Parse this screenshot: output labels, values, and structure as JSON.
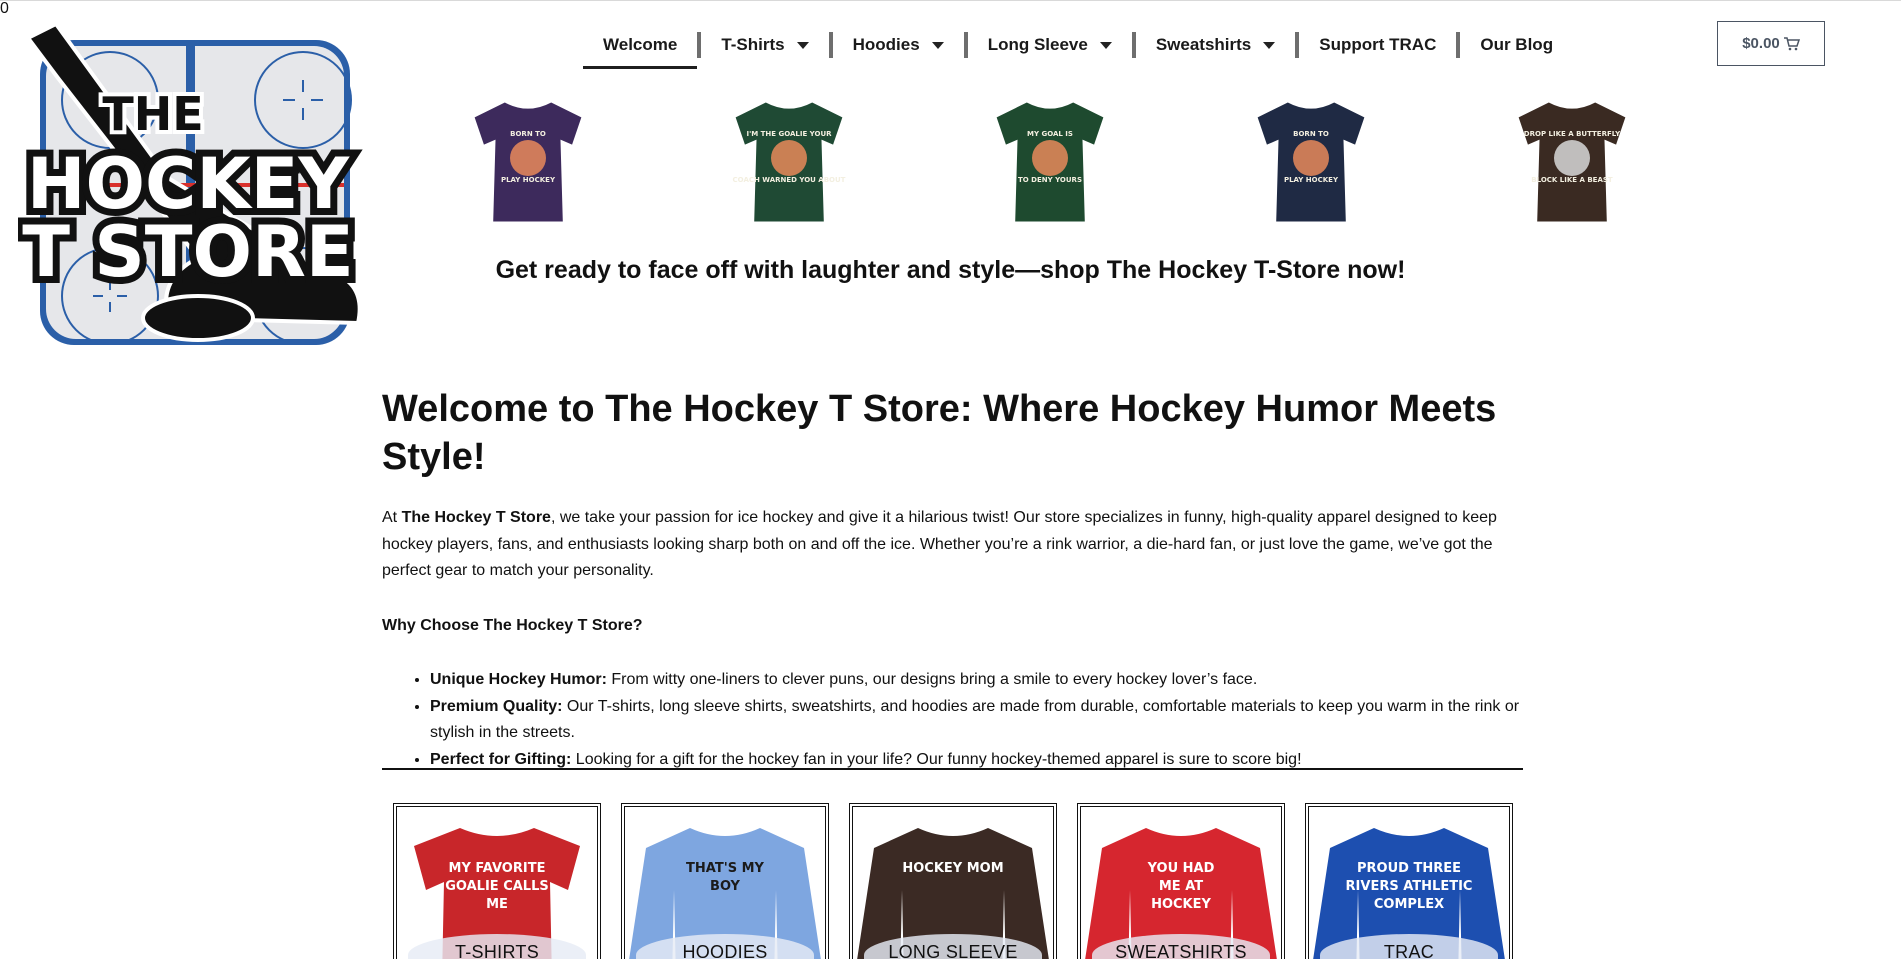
{
  "brand": {
    "logo_line1": "THE",
    "logo_line2": "HOCKEY",
    "logo_line3": "T STORE",
    "colors": {
      "rink_blue": "#2b5fa8",
      "rink_red": "#d9302c",
      "ice": "#e6e7ea"
    }
  },
  "nav": {
    "items": [
      {
        "label": "Welcome",
        "dropdown": false,
        "active": true
      },
      {
        "label": "T-Shirts",
        "dropdown": true
      },
      {
        "label": "Hoodies",
        "dropdown": true
      },
      {
        "label": "Long Sleeve",
        "dropdown": true
      },
      {
        "label": "Sweatshirts",
        "dropdown": true
      },
      {
        "label": "Support TRAC",
        "dropdown": false
      },
      {
        "label": "Our Blog",
        "dropdown": false
      }
    ]
  },
  "cart": {
    "total": "$0.00",
    "count": "0",
    "icon": "cart-icon",
    "badge_color": "#d9534f"
  },
  "featured_shirts": [
    {
      "color": "#3d2a5c",
      "print": "BORN TO PLAY HOCKEY",
      "icon": "shirt-icon"
    },
    {
      "color": "#1f4a34",
      "print": "I'M THE GOALIE YOUR COACH WARNED YOU ABOUT",
      "icon": "shirt-icon"
    },
    {
      "color": "#1e4a2f",
      "print": "MY GOAL IS TO DENY YOURS",
      "icon": "shirt-icon"
    },
    {
      "color": "#1f2a44",
      "print": "BORN TO PLAY HOCKEY",
      "icon": "shirt-icon"
    },
    {
      "color": "#3a2a22",
      "print": "DROP LIKE A BUTTERFLY BLOCK LIKE A BEAST",
      "icon": "shirt-icon"
    }
  ],
  "tagline": "Get ready to face off with laughter and style—shop The Hockey T-Store now!",
  "welcome": {
    "heading": "Welcome to The Hockey T Store: Where Hockey Humor Meets Style!",
    "intro_prefix": "At ",
    "intro_bold": "The Hockey T Store",
    "intro_rest": ", we take your passion for ice hockey and give it a hilarious twist! Our store specializes in funny, high-quality apparel designed to keep hockey players, fans, and enthusiasts looking sharp both on and off the ice. Whether you’re a rink warrior, a die-hard fan, or just love the game, we’ve got the perfect gear to match your personality.",
    "why_heading": "Why Choose The Hockey T Store?",
    "bullets": [
      {
        "bold": "Unique Hockey Humor:",
        "text": " From witty one-liners to clever puns, our designs bring a smile to every hockey lover’s face."
      },
      {
        "bold": "Premium Quality:",
        "text": " Our T-shirts, long sleeve shirts, sweatshirts, and hoodies are made from durable, comfortable materials to keep you warm in the rink or stylish in the streets."
      },
      {
        "bold": "Perfect for Gifting:",
        "text": " Looking for a gift for the hockey fan in your life? Our funny hockey-themed apparel is sure to score big!"
      }
    ]
  },
  "categories": [
    {
      "label": "T-SHIRTS",
      "color": "#c8262a",
      "print": "MY FAVORITE GOALIE CALLS ME"
    },
    {
      "label": "HOODIES",
      "color": "#7ea6e0",
      "print": "THAT'S MY BOY"
    },
    {
      "label": "LONG SLEEVE",
      "color": "#3b2a24",
      "print": "HOCKEY MOM"
    },
    {
      "label": "SWEATSHIRTS",
      "color": "#d6262f",
      "print": "YOU HAD ME AT HOCKEY"
    },
    {
      "label": "TRAC",
      "color": "#1d4fb0",
      "print": "PROUD THREE RIVERS ATHLETIC COMPLEX"
    }
  ]
}
